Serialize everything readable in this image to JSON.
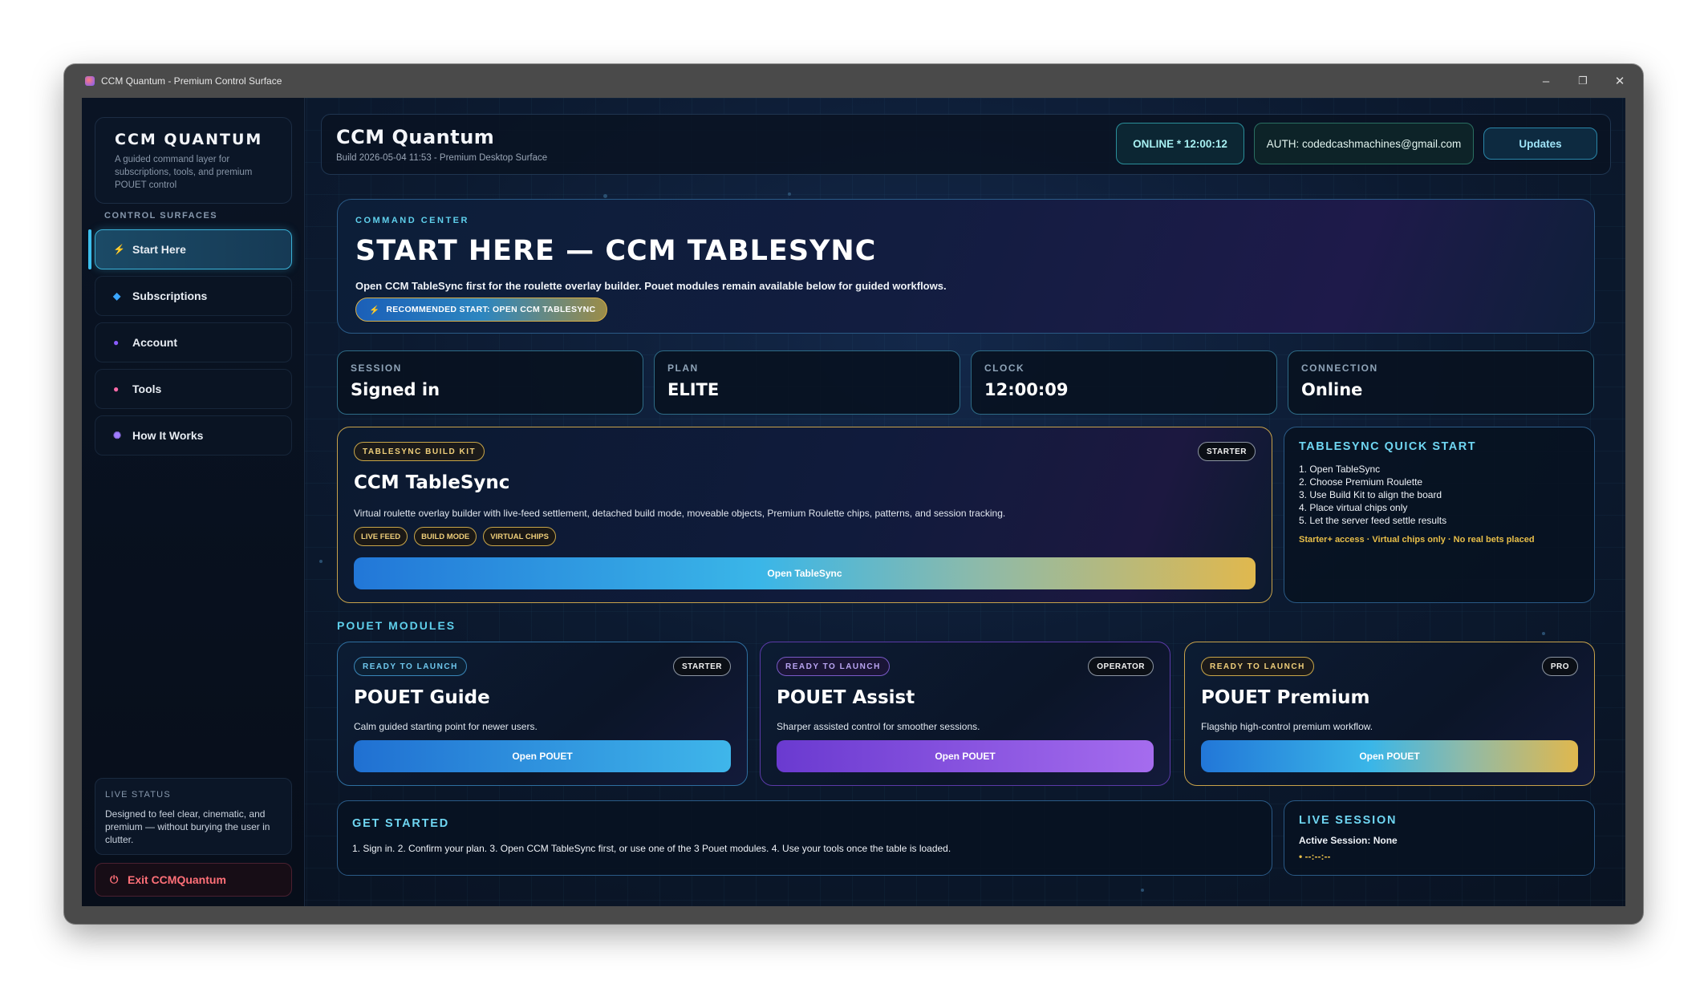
{
  "window": {
    "title": "CCM Quantum - Premium Control Surface",
    "controls": {
      "minimize": "–",
      "maximize": "❐",
      "close": "✕"
    }
  },
  "sidebar": {
    "brand_title": "CCM QUANTUM",
    "brand_desc": "A guided command layer for subscriptions, tools, and premium POUET control",
    "section_label": "CONTROL SURFACES",
    "items": [
      {
        "label": "Start Here",
        "icon": "bolt-icon",
        "glyph": "⚡",
        "color": "#ff8a2a",
        "active": true
      },
      {
        "label": "Subscriptions",
        "icon": "diamond-icon",
        "glyph": "◆",
        "color": "#3aa6ff"
      },
      {
        "label": "Account",
        "icon": "user-icon",
        "glyph": "●",
        "color": "#8a5cff"
      },
      {
        "label": "Tools",
        "icon": "brain-icon",
        "glyph": "●",
        "color": "#ff6aa8"
      },
      {
        "label": "How It Works",
        "icon": "sparkle-icon",
        "glyph": "✺",
        "color": "#a07cff"
      }
    ],
    "live_status_label": "LIVE STATUS",
    "live_status_text": "Designed to feel clear, cinematic, and premium — without burying the user in clutter.",
    "exit_label": "Exit CCMQuantum",
    "exit_icon": "power-icon"
  },
  "header": {
    "title": "CCM Quantum",
    "subtitle": "Build 2026-05-04 11:53 - Premium Desktop Surface",
    "online_status": "ONLINE *  12:00:12",
    "auth": "AUTH: codedcashmachines@gmail.com",
    "updates_label": "Updates"
  },
  "hero": {
    "kicker": "COMMAND CENTER",
    "title": "START HERE — CCM TABLESYNC",
    "desc": "Open CCM TableSync first for the roulette overlay builder. Pouet modules remain available below for guided workflows.",
    "cta_label": "RECOMMENDED START: OPEN CCM TABLESYNC"
  },
  "stats": [
    {
      "key": "SESSION",
      "value": "Signed in"
    },
    {
      "key": "PLAN",
      "value": "ELITE"
    },
    {
      "key": "CLOCK",
      "value": "12:00:09"
    },
    {
      "key": "CONNECTION",
      "value": "Online"
    }
  ],
  "tablesync": {
    "tag": "TABLESYNC BUILD KIT",
    "tier": "STARTER",
    "title": "CCM TableSync",
    "desc": "Virtual roulette overlay builder with live-feed settlement, detached build mode, moveable objects, Premium Roulette chips, patterns, and session tracking.",
    "tags": [
      "LIVE FEED",
      "BUILD MODE",
      "VIRTUAL CHIPS"
    ],
    "button": "Open TableSync"
  },
  "quick_start": {
    "title": "TABLESYNC QUICK START",
    "steps": [
      "1. Open TableSync",
      "2. Choose Premium Roulette",
      "3. Use Build Kit to align the board",
      "4. Place virtual chips only",
      "5. Let the server feed settle results"
    ],
    "note": "Starter+ access · Virtual chips only · No real bets placed"
  },
  "modules_title": "POUET MODULES",
  "modules": [
    {
      "status": "READY TO LAUNCH",
      "tier": "STARTER",
      "title": "POUET Guide",
      "desc": "Calm guided starting point for newer users.",
      "button": "Open POUET",
      "border": "#2e6fa0"
    },
    {
      "status": "READY TO LAUNCH",
      "tier": "OPERATOR",
      "title": "POUET Assist",
      "desc": "Sharper assisted control for smoother sessions.",
      "button": "Open POUET",
      "border": "#5b3aa8"
    },
    {
      "status": "READY TO LAUNCH",
      "tier": "PRO",
      "title": "POUET Premium",
      "desc": "Flagship high-control premium workflow.",
      "button": "Open POUET",
      "border": "#c8a24a"
    }
  ],
  "get_started": {
    "title": "GET STARTED",
    "desc": "1. Sign in. 2. Confirm your plan. 3. Open CCM TableSync first, or use one of the 3 Pouet modules. 4. Use your tools once the table is loaded."
  },
  "live_session": {
    "title": "LIVE SESSION",
    "line1": "Active Session: None",
    "line2": "• --:--:--"
  }
}
